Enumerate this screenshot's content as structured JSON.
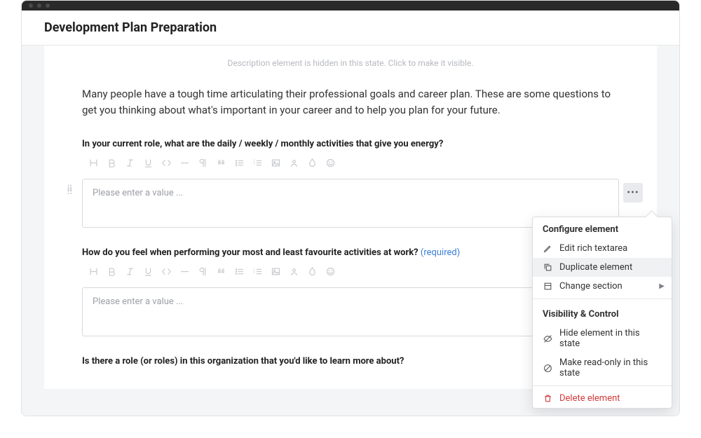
{
  "header": {
    "title": "Development Plan Preparation"
  },
  "hidden_description": "Description element is hidden in this state. Click to make it visible.",
  "intro": "Many people have a tough time articulating their professional goals and career plan. These are some questions to get you thinking about what's important in your career and to help you plan for your future.",
  "placeholder": "Please enter a value ...",
  "required_label": "(required)",
  "questions": [
    {
      "label": "In your current role, what are the daily / weekly / monthly activities that give you energy?",
      "required": false
    },
    {
      "label": "How do you feel when performing your most and least favourite activities at work?",
      "required": true
    },
    {
      "label": "Is there a role (or roles) in this organization that you'd like to learn more about?",
      "required": false
    }
  ],
  "toolbar_icons": [
    "heading",
    "bold",
    "italic",
    "underline",
    "code",
    "rule",
    "paragraph",
    "quote",
    "bullet-list",
    "ordered-list",
    "image",
    "user",
    "drop",
    "smile"
  ],
  "popover": {
    "section1_title": "Configure element",
    "items1": [
      {
        "icon": "pencil",
        "label": "Edit rich textarea"
      },
      {
        "icon": "duplicate",
        "label": "Duplicate element",
        "hover": true
      },
      {
        "icon": "section",
        "label": "Change section",
        "submenu": true
      }
    ],
    "section2_title": "Visibility & Control",
    "items2": [
      {
        "icon": "eye-off",
        "label": "Hide element in this state"
      },
      {
        "icon": "prohibit",
        "label": "Make read-only in this state"
      }
    ],
    "delete_label": "Delete element"
  }
}
